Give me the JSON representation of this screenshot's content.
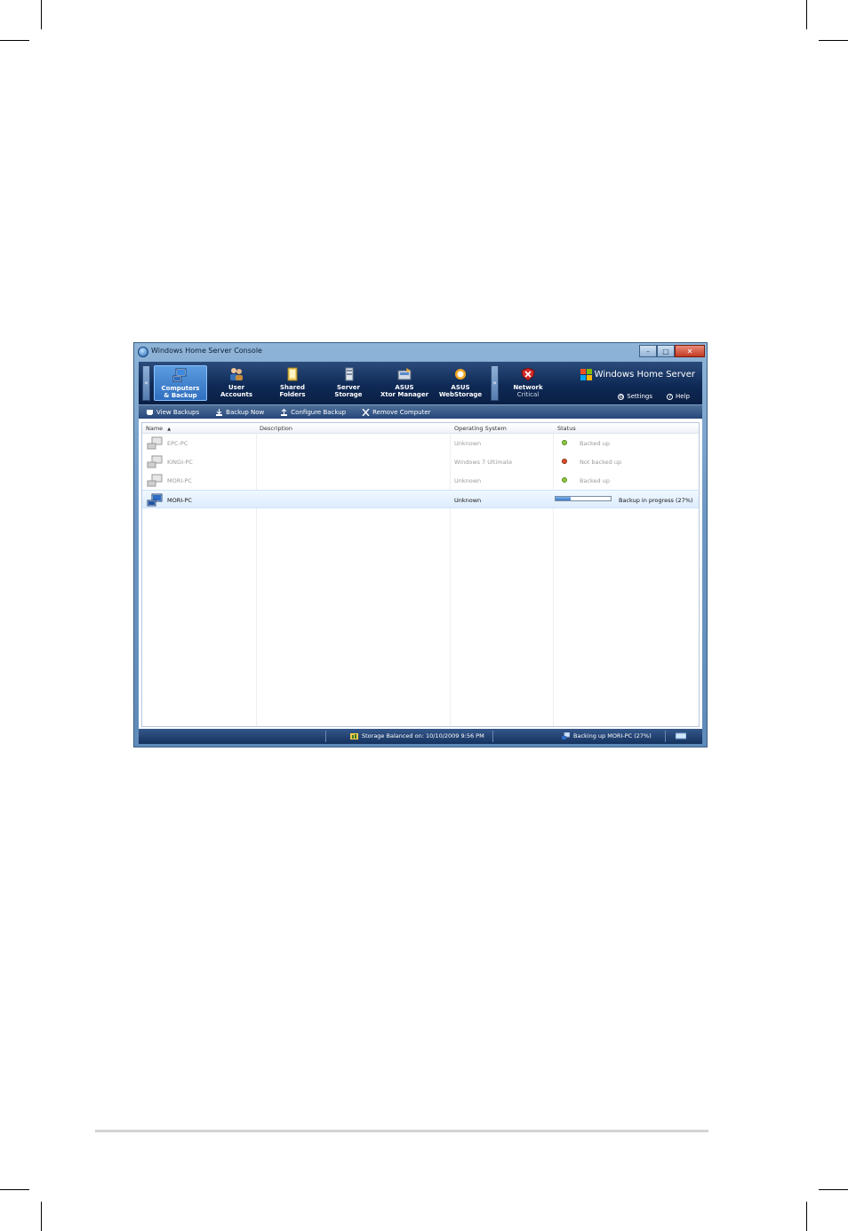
{
  "window": {
    "title": "Windows Home Server Console",
    "min_label": "–",
    "max_label": "□",
    "close_label": "✕"
  },
  "nav": {
    "tabs": [
      {
        "line1": "Computers",
        "line2": "& Backup",
        "icon": "computers-icon",
        "active": true
      },
      {
        "line1": "User",
        "line2": "Accounts",
        "icon": "users-icon"
      },
      {
        "line1": "Shared",
        "line2": "Folders",
        "icon": "folders-icon"
      },
      {
        "line1": "Server",
        "line2": "Storage",
        "icon": "storage-icon"
      },
      {
        "line1": "ASUS",
        "line2": "Xtor Manager",
        "icon": "xtor-icon"
      },
      {
        "line1": "ASUS",
        "line2": "WebStorage",
        "icon": "webstorage-icon"
      }
    ],
    "network": {
      "label": "Network",
      "status": "Critical",
      "icon": "network-critical-icon"
    },
    "scroll_left": "«",
    "scroll_right": "»",
    "brand": "Windows Home Server",
    "settings": "Settings",
    "help": "Help"
  },
  "toolbar": {
    "view_backups": "View Backups",
    "backup_now": "Backup Now",
    "configure_backup": "Configure Backup",
    "remove_computer": "Remove Computer"
  },
  "table": {
    "headers": {
      "name": "Name",
      "sort_indicator": "▲",
      "description": "Description",
      "os": "Operating System",
      "status": "Status"
    },
    "rows": [
      {
        "name": "EPC-PC",
        "description": "",
        "os": "Unknown",
        "status": "Backed up",
        "status_color": "#8dc63f"
      },
      {
        "name": "KINGI-PC",
        "description": "",
        "os": "Windows 7 Ultimate",
        "status": "Not backed up",
        "status_color": "#e0502a"
      },
      {
        "name": "MORI-PC",
        "description": "",
        "os": "Unknown",
        "status": "Backed up",
        "status_color": "#8dc63f"
      },
      {
        "name": "MORI-PC",
        "description": "",
        "os": "Unknown",
        "status": "Backup in progress (27%)",
        "progress": 0.27,
        "selected": true
      }
    ]
  },
  "statusbar": {
    "storage": "Storage Balanced on: 10/10/2009 9:56 PM",
    "backup": "Backing up MORI-PC (27%)"
  }
}
